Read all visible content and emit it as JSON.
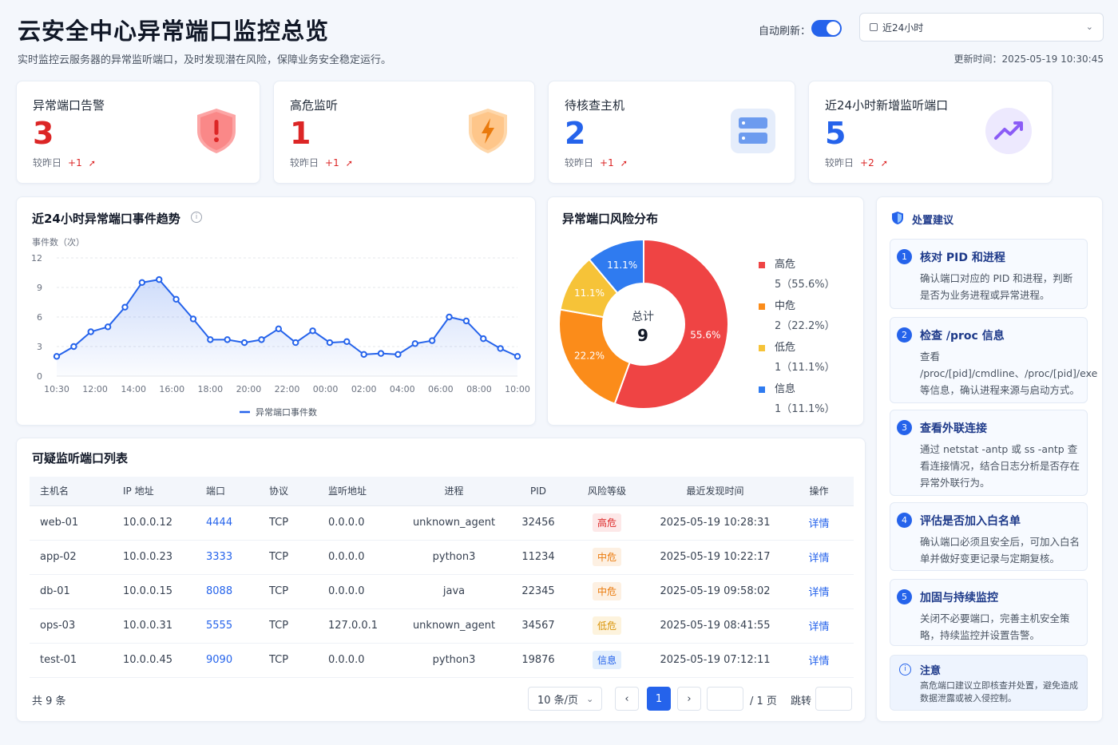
{
  "header": {
    "title": "云安全中心异常端口监控总览",
    "subtitle": "实时监控云服务器的异常监听端口，及时发现潜在风险，保障业务安全稳定运行。",
    "auto_refresh_label": "自动刷新：",
    "auto_refresh_on": true,
    "time_range": "近24小时",
    "updated_label": "更新时间：",
    "updated_time": "2025-05-19 10:30:45"
  },
  "kpis": [
    {
      "label": "异常端口告警",
      "value": "3",
      "cmp_label": "较昨日",
      "delta": "+1",
      "arrow": "➚",
      "color": "#dc2626",
      "icon": "shield-alert-icon"
    },
    {
      "label": "高危监听",
      "value": "1",
      "cmp_label": "较昨日",
      "delta": "+1",
      "arrow": "➚",
      "color": "#dc2626",
      "icon": "shield-bolt-icon"
    },
    {
      "label": "待核查主机",
      "value": "2",
      "cmp_label": "较昨日",
      "delta": "+1",
      "arrow": "➚",
      "color": "#2563eb",
      "icon": "server-icon"
    },
    {
      "label": "近24小时新增监听端口",
      "value": "5",
      "cmp_label": "较昨日",
      "delta": "+2",
      "arrow": "➚",
      "color": "#2563eb",
      "icon": "trend-up-icon"
    }
  ],
  "trend": {
    "title": "近24小时异常端口事件趋势",
    "info_icon": "info-icon",
    "chart_data": {
      "type": "line",
      "ylabel": "事件数（次）",
      "ylim": [
        0,
        12
      ],
      "yticks": [
        "0",
        "3",
        "6",
        "9",
        "12"
      ],
      "xticks": [
        "10:30",
        "12:00",
        "14:00",
        "16:00",
        "18:00",
        "20:00",
        "22:00",
        "00:00",
        "02:00",
        "04:00",
        "06:00",
        "08:00",
        "10:00"
      ],
      "series": [
        {
          "name": "异常端口事件数",
          "color": "#2563eb",
          "values": [
            2,
            3,
            4.5,
            5,
            7,
            9.5,
            9.8,
            7.8,
            5.8,
            3.7,
            3.7,
            3.4,
            3.7,
            4.8,
            3.4,
            4.6,
            3.4,
            3.5,
            2.2,
            2.3,
            2.2,
            3.3,
            3.6,
            6,
            5.6,
            3.8,
            2.8,
            2
          ]
        }
      ]
    }
  },
  "dist": {
    "title": "异常端口风险分布",
    "center_label": "总计",
    "center_value": "9",
    "chart_data": {
      "type": "pie",
      "slices": [
        {
          "name": "高危",
          "value": 5,
          "count_text": "5（55.6%）",
          "pct_label": "55.6%",
          "color": "#ef4444"
        },
        {
          "name": "中危",
          "value": 2,
          "count_text": "2（22.2%）",
          "pct_label": "22.2%",
          "color": "#fb8c1a"
        },
        {
          "name": "低危",
          "value": 1,
          "count_text": "1（11.1%）",
          "pct_label": "11.1%",
          "color": "#f6c338"
        },
        {
          "name": "信息",
          "value": 1,
          "count_text": "1（11.1%）",
          "pct_label": "11.1%",
          "color": "#2f7bf0"
        }
      ]
    }
  },
  "table": {
    "title": "可疑监听端口列表",
    "columns": [
      "主机名",
      "IP 地址",
      "端口",
      "协议",
      "监听地址",
      "进程",
      "PID",
      "风险等级",
      "最近发现时间",
      "操作"
    ],
    "rows": [
      {
        "host": "web-01",
        "ip": "10.0.0.12",
        "port": "4444",
        "proto": "TCP",
        "listen": "0.0.0.0",
        "proc": "unknown_agent",
        "pid": "32456",
        "risk": "高危",
        "risk_class": "b-high",
        "time": "2025-05-19 10:28:31",
        "action": "详情"
      },
      {
        "host": "app-02",
        "ip": "10.0.0.23",
        "port": "3333",
        "proto": "TCP",
        "listen": "0.0.0.0",
        "proc": "python3",
        "pid": "11234",
        "risk": "中危",
        "risk_class": "b-mid",
        "time": "2025-05-19 10:22:17",
        "action": "详情"
      },
      {
        "host": "db-01",
        "ip": "10.0.0.15",
        "port": "8088",
        "proto": "TCP",
        "listen": "0.0.0.0",
        "proc": "java",
        "pid": "22345",
        "risk": "中危",
        "risk_class": "b-mid",
        "time": "2025-05-19 09:58:02",
        "action": "详情"
      },
      {
        "host": "ops-03",
        "ip": "10.0.0.31",
        "port": "5555",
        "proto": "TCP",
        "listen": "127.0.0.1",
        "proc": "unknown_agent",
        "pid": "34567",
        "risk": "低危",
        "risk_class": "b-low",
        "time": "2025-05-19 08:41:55",
        "action": "详情"
      },
      {
        "host": "test-01",
        "ip": "10.0.0.45",
        "port": "9090",
        "proto": "TCP",
        "listen": "0.0.0.0",
        "proc": "python3",
        "pid": "19876",
        "risk": "信息",
        "risk_class": "b-info",
        "time": "2025-05-19 07:12:11",
        "action": "详情"
      }
    ],
    "total": "共 9 条",
    "page_size": "10 条/页",
    "current_page": "1",
    "page_total": "/ 1 页",
    "jump_label": "跳转"
  },
  "advice": {
    "title": "处置建议",
    "items": [
      {
        "num": "1",
        "title": "核对 PID 和进程",
        "desc": "确认端口对应的 PID 和进程，判断是否为业务进程或异常进程。"
      },
      {
        "num": "2",
        "title": "检查 /proc 信息",
        "desc": "查看 /proc/[pid]/cmdline、/proc/[pid]/exe 等信息，确认进程来源与启动方式。"
      },
      {
        "num": "3",
        "title": "查看外联连接",
        "desc": "通过 netstat -antp  或 ss -antp 查看连接情况，结合日志分析是否存在异常外联行为。"
      },
      {
        "num": "4",
        "title": "评估是否加入白名单",
        "desc": "确认端口必须且安全后，可加入白名单并做好变更记录与定期复核。"
      },
      {
        "num": "5",
        "title": "加固与持续监控",
        "desc": "关闭不必要端口，完善主机安全策略，持续监控并设置告警。"
      }
    ],
    "note_title": "注意",
    "note_desc": "高危端口建议立即核查并处置，避免造成数据泄露或被入侵控制。"
  }
}
